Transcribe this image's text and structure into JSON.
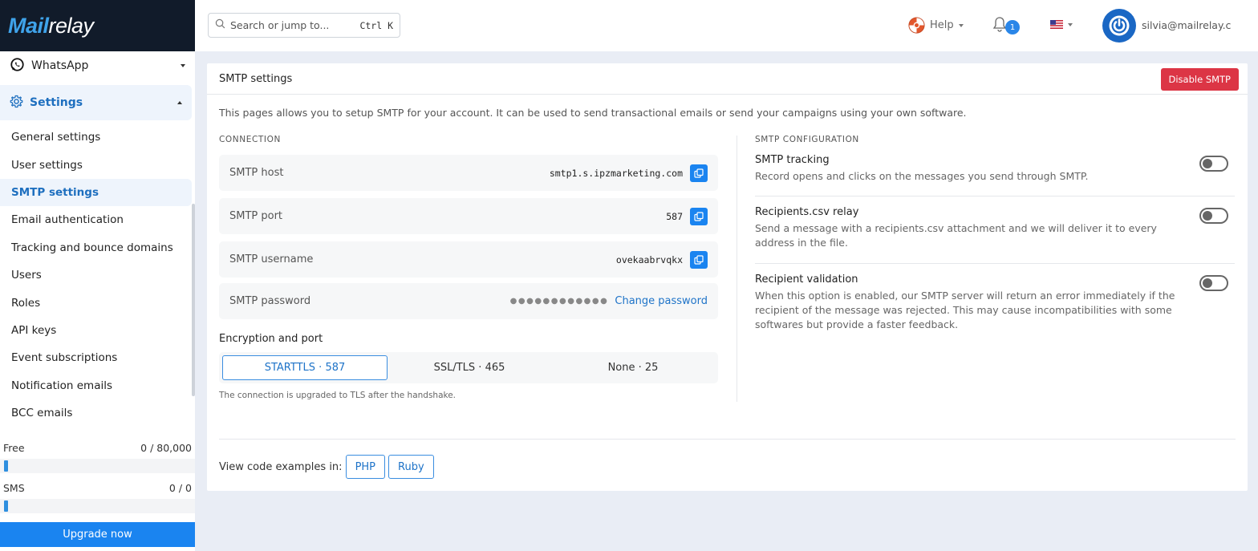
{
  "brand": {
    "logo_text_a": "M",
    "logo_text_b": "ail",
    "logo_text_c": "relay"
  },
  "sidebar": {
    "whatsapp_label": "WhatsApp",
    "settings_label": "Settings",
    "items": [
      {
        "label": "General settings"
      },
      {
        "label": "User settings"
      },
      {
        "label": "SMTP settings"
      },
      {
        "label": "Email authentication"
      },
      {
        "label": "Tracking and bounce domains"
      },
      {
        "label": "Users"
      },
      {
        "label": "Roles"
      },
      {
        "label": "API keys"
      },
      {
        "label": "Event subscriptions"
      },
      {
        "label": "Notification emails"
      },
      {
        "label": "BCC emails"
      }
    ],
    "active_item": "SMTP settings",
    "quota_free": {
      "label": "Free",
      "value": "0 / 80,000"
    },
    "quota_sms": {
      "label": "SMS",
      "value": "0 / 0"
    },
    "upgrade_label": "Upgrade now"
  },
  "topbar": {
    "search_placeholder": "Search or jump to...",
    "search_shortcut": "Ctrl K",
    "help_label": "Help",
    "notification_count": "1",
    "user_email": "silvia@mailrelay.com"
  },
  "card": {
    "title": "SMTP settings",
    "disable_button": "Disable SMTP",
    "intro": "This pages allows you to setup SMTP for your account. It can be used to send transactional emails or send your campaigns using your own software.",
    "connection_label": "CONNECTION",
    "fields": {
      "host": {
        "name": "SMTP host",
        "value": "smtp1.s.ipzmarketing.com"
      },
      "port": {
        "name": "SMTP port",
        "value": "587"
      },
      "username": {
        "name": "SMTP username",
        "value": "ovekaabrvqkx"
      },
      "password": {
        "name": "SMTP password",
        "masked": "●●●●●●●●●●●●",
        "change_label": "Change password"
      }
    },
    "encryption": {
      "title": "Encryption and port",
      "options": [
        "STARTTLS · 587",
        "SSL/TLS · 465",
        "None · 25"
      ],
      "selected": "STARTTLS · 587",
      "note": "The connection is upgraded to TLS after the handshake."
    },
    "config_label": "SMTP CONFIGURATION",
    "config": [
      {
        "title": "SMTP tracking",
        "desc": "Record opens and clicks on the messages you send through SMTP.",
        "enabled": false
      },
      {
        "title": "Recipients.csv relay",
        "desc": "Send a message with a recipients.csv attachment and we will deliver it to every address in the file.",
        "enabled": false
      },
      {
        "title": "Recipient validation",
        "desc": "When this option is enabled, our SMTP server will return an error immediately if the recipient of the message was rejected. This may cause incompatibilities with some softwares but provide a faster feedback.",
        "enabled": false
      }
    ],
    "examples_label": "View code examples in:",
    "examples": [
      "PHP",
      "Ruby"
    ]
  },
  "colors": {
    "accent": "#1a84f0",
    "danger": "#dc3545",
    "sidebar_dark": "#111b2a"
  },
  "icons": {
    "whatsapp": "whatsapp-icon",
    "settings": "gear-icon",
    "search": "search-icon",
    "help": "lifebuoy-icon",
    "bell": "bell-icon",
    "flag": "us-flag-icon",
    "avatar": "power-icon",
    "copy": "copy-icon"
  }
}
